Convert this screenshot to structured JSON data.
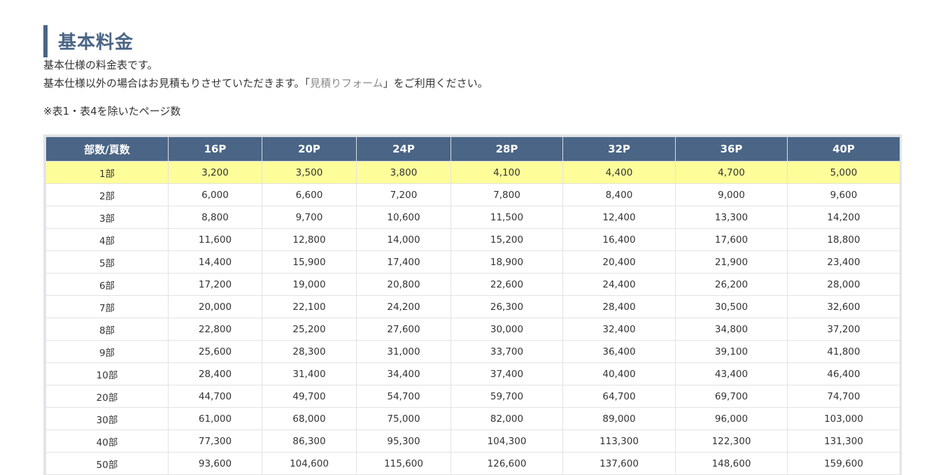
{
  "page": {
    "heading": "基本料金",
    "intro_line1": "基本仕様の料金表です。",
    "intro_line2_prefix": "基本仕様以外の場合はお見積もりさせていただきます。「",
    "form_link": "見積りフォーム",
    "intro_line2_suffix": "」をご利用ください。",
    "note": "※表1・表4を除いたページ数"
  },
  "table": {
    "headers": [
      "部数/頁数",
      "16P",
      "20P",
      "24P",
      "28P",
      "32P",
      "36P",
      "40P"
    ],
    "highlight_row_index": 0,
    "highlight_color": "#fdfd9a",
    "header_color": "#4a6585",
    "rows": [
      [
        "1部",
        "3,200",
        "3,500",
        "3,800",
        "4,100",
        "4,400",
        "4,700",
        "5,000"
      ],
      [
        "2部",
        "6,000",
        "6,600",
        "7,200",
        "7,800",
        "8,400",
        "9,000",
        "9,600"
      ],
      [
        "3部",
        "8,800",
        "9,700",
        "10,600",
        "11,500",
        "12,400",
        "13,300",
        "14,200"
      ],
      [
        "4部",
        "11,600",
        "12,800",
        "14,000",
        "15,200",
        "16,400",
        "17,600",
        "18,800"
      ],
      [
        "5部",
        "14,400",
        "15,900",
        "17,400",
        "18,900",
        "20,400",
        "21,900",
        "23,400"
      ],
      [
        "6部",
        "17,200",
        "19,000",
        "20,800",
        "22,600",
        "24,400",
        "26,200",
        "28,000"
      ],
      [
        "7部",
        "20,000",
        "22,100",
        "24,200",
        "26,300",
        "28,400",
        "30,500",
        "32,600"
      ],
      [
        "8部",
        "22,800",
        "25,200",
        "27,600",
        "30,000",
        "32,400",
        "34,800",
        "37,200"
      ],
      [
        "9部",
        "25,600",
        "28,300",
        "31,000",
        "33,700",
        "36,400",
        "39,100",
        "41,800"
      ],
      [
        "10部",
        "28,400",
        "31,400",
        "34,400",
        "37,400",
        "40,400",
        "43,400",
        "46,400"
      ],
      [
        "20部",
        "44,700",
        "49,700",
        "54,700",
        "59,700",
        "64,700",
        "69,700",
        "74,700"
      ],
      [
        "30部",
        "61,000",
        "68,000",
        "75,000",
        "82,000",
        "89,000",
        "96,000",
        "103,000"
      ],
      [
        "40部",
        "77,300",
        "86,300",
        "95,300",
        "104,300",
        "113,300",
        "122,300",
        "131,300"
      ],
      [
        "50部",
        "93,600",
        "104,600",
        "115,600",
        "126,600",
        "137,600",
        "148,600",
        "159,600"
      ]
    ]
  }
}
